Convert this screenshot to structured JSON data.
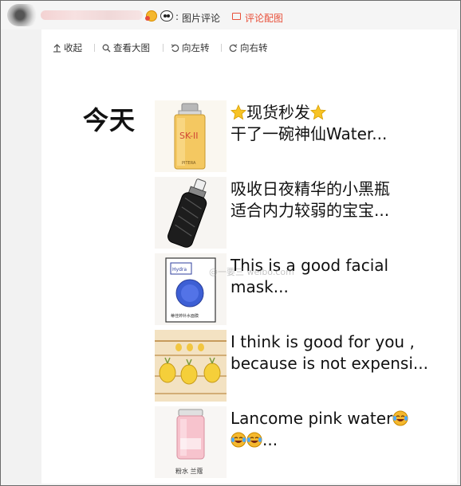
{
  "header": {
    "pic_comment_label": "图片评论",
    "comment_with_pic_label": "评论配图"
  },
  "toolbar": {
    "collapse_label": "收起",
    "view_large_label": "查看大图",
    "rotate_left_label": "向左转",
    "rotate_right_label": "向右转"
  },
  "content": {
    "date_label": "今天",
    "watermark": "@一要三 weibo.com",
    "items": [
      {
        "line1": "现货秒发",
        "line2": "干了一碗神仙Water...",
        "thumb": "skii-bottle",
        "thumb_label": "SK-II",
        "thumb_sub": "PITERA"
      },
      {
        "line1": "吸收日夜精华的小黑瓶",
        "line2": "适合内力较弱的宝宝...",
        "thumb": "black-serum-bottle"
      },
      {
        "line1": "This is a good facial",
        "line2": "mask...",
        "thumb": "sheet-mask",
        "thumb_label": "Hydra",
        "thumb_sub": "蒂佳婷补水面膜"
      },
      {
        "line1": "I think is good for you ,",
        "line2": "because is not expensi...",
        "thumb": "pineapple-drawing"
      },
      {
        "line1": "Lancome pink water",
        "line2": "...",
        "thumb": "pink-toner-bottle",
        "thumb_sub": "粉水 兰蔻"
      }
    ]
  },
  "colors": {
    "accent_red": "#e8503a",
    "star": "#f7c325",
    "emoji": "#f5b82e"
  },
  "icons": [
    "collapse-icon",
    "search-icon",
    "rotate-left-icon",
    "rotate-right-icon",
    "picture-icon",
    "star-icon",
    "laughing-crying-emoji"
  ]
}
